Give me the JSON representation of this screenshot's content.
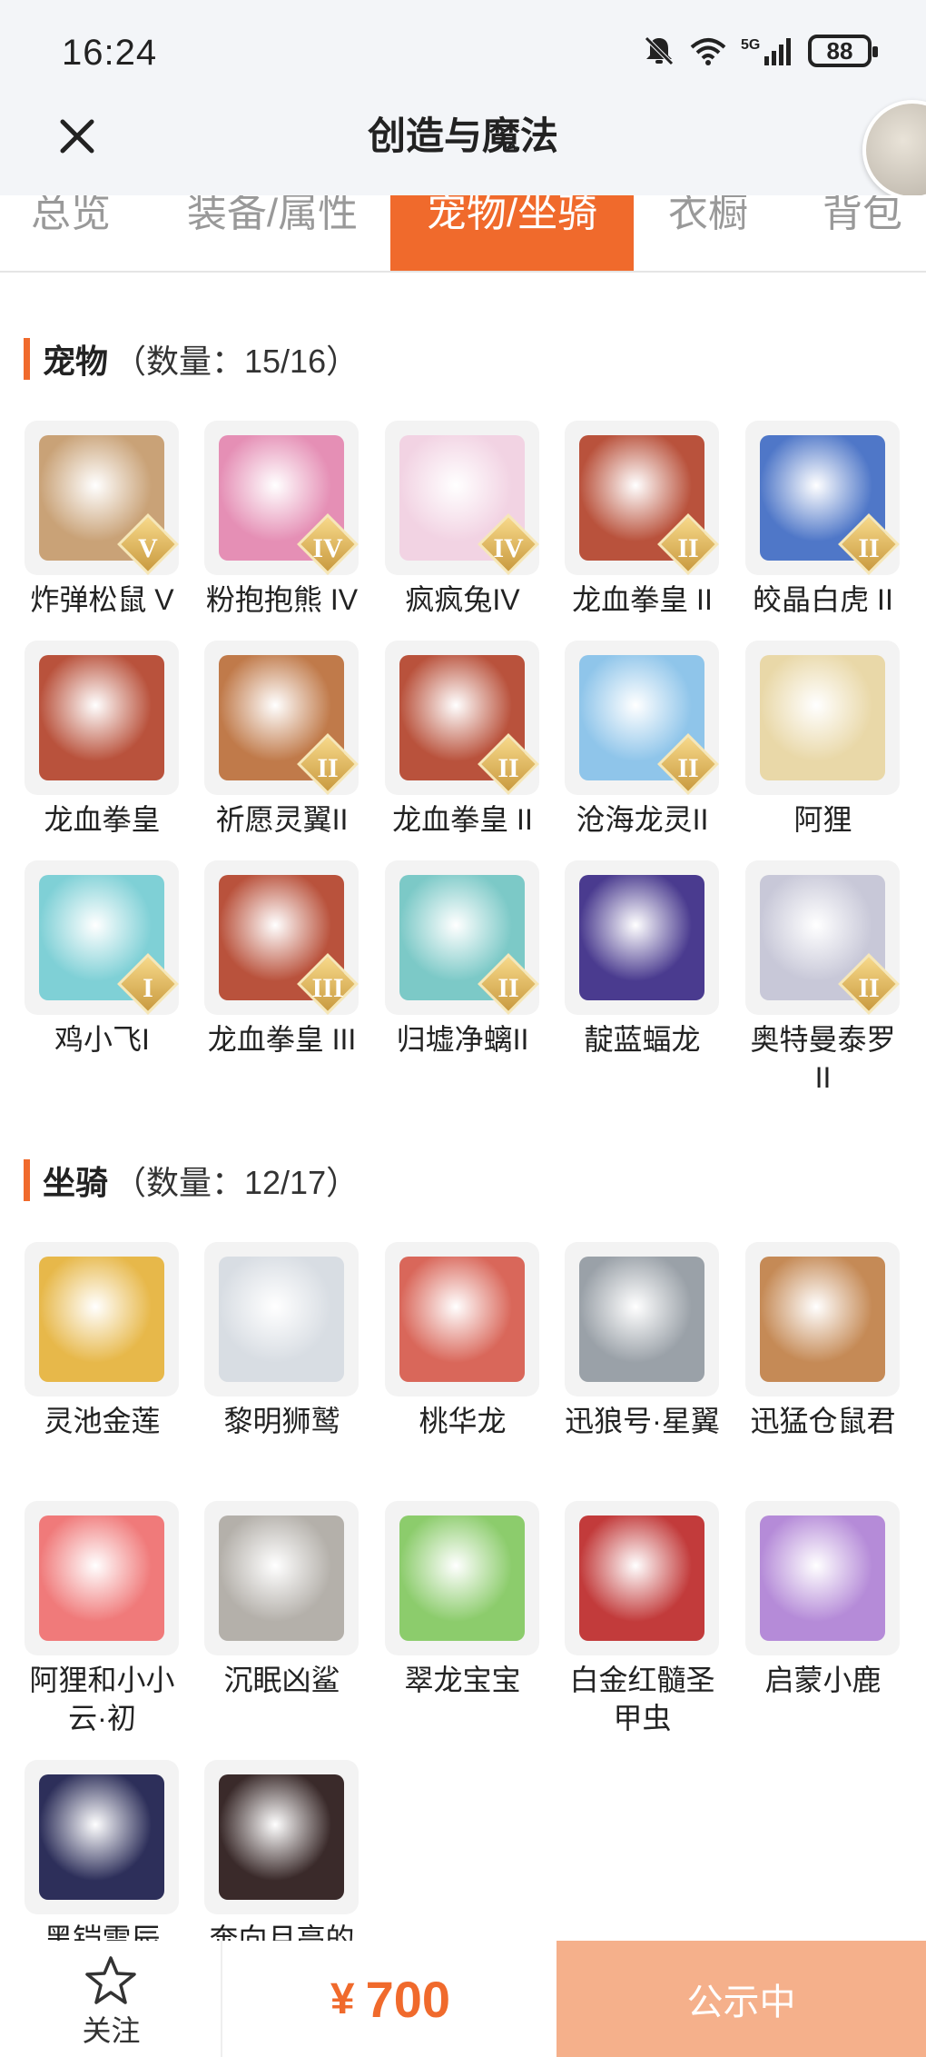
{
  "status_bar": {
    "time": "16:24",
    "battery": "88",
    "network": "5G"
  },
  "header": {
    "title": "创造与魔法"
  },
  "tabs": [
    {
      "label": "总览",
      "active": false
    },
    {
      "label": "装备/属性",
      "active": false
    },
    {
      "label": "宠物/坐骑",
      "active": true
    },
    {
      "label": "衣橱",
      "active": false
    },
    {
      "label": "背包",
      "active": false
    }
  ],
  "pets": {
    "title": "宠物",
    "count": "（数量：15/16）",
    "items": [
      {
        "label": "炸弹松鼠 V",
        "badge": "V",
        "color": "#c9a277"
      },
      {
        "label": "粉抱抱熊 IV",
        "badge": "IV",
        "color": "#e58fb5"
      },
      {
        "label": "疯疯兔IV",
        "badge": "IV",
        "color": "#f2d3e3"
      },
      {
        "label": "龙血拳皇 II",
        "badge": "II",
        "color": "#b9523c"
      },
      {
        "label": "皎晶白虎 II",
        "badge": "II",
        "color": "#4f77c8"
      },
      {
        "label": "龙血拳皇",
        "badge": "",
        "color": "#b9523c"
      },
      {
        "label": "祈愿灵翼II",
        "badge": "II",
        "color": "#c07a4a"
      },
      {
        "label": "龙血拳皇 II",
        "badge": "II",
        "color": "#b9523c"
      },
      {
        "label": "沧海龙灵II",
        "badge": "II",
        "color": "#8fc5ea"
      },
      {
        "label": "阿狸",
        "badge": "",
        "color": "#e9d8a8"
      },
      {
        "label": "鸡小飞I",
        "badge": "I",
        "color": "#7fd0d6"
      },
      {
        "label": "龙血拳皇 III",
        "badge": "III",
        "color": "#b9523c"
      },
      {
        "label": "归墟净螭II",
        "badge": "II",
        "color": "#7cc9c7"
      },
      {
        "label": "靛蓝蝠龙",
        "badge": "",
        "color": "#4a3b8f"
      },
      {
        "label": "奥特曼泰罗 II",
        "badge": "II",
        "color": "#c8c8d8"
      }
    ]
  },
  "mounts": {
    "title": "坐骑",
    "count": "（数量：12/17）",
    "items": [
      {
        "label": "灵池金莲",
        "color": "#e7b84a"
      },
      {
        "label": "黎明狮鹫",
        "color": "#d8dde3"
      },
      {
        "label": "桃华龙",
        "color": "#d9675a"
      },
      {
        "label": "迅狼号·星翼",
        "color": "#9aa1a8"
      },
      {
        "label": "迅猛仓鼠君",
        "color": "#c58a56"
      },
      {
        "label": "阿狸和小小云·初",
        "color": "#f07a7a"
      },
      {
        "label": "沉眠凶鲨",
        "color": "#b4b0aa"
      },
      {
        "label": "翠龙宝宝",
        "color": "#8ccc6c"
      },
      {
        "label": "白金红髓圣甲虫",
        "color": "#c23b3b"
      },
      {
        "label": "启蒙小鹿",
        "color": "#b58bd8"
      },
      {
        "label": "黑铠雷辰",
        "color": "#2d2f5a"
      },
      {
        "label": "奔向月亮的",
        "color": "#3a2a2a"
      }
    ]
  },
  "bottom_bar": {
    "follow_label": "关注",
    "currency": "¥",
    "price": "700",
    "status_label": "公示中"
  },
  "colors": {
    "accent": "#f06a2c",
    "status_button": "#f5b08b"
  }
}
